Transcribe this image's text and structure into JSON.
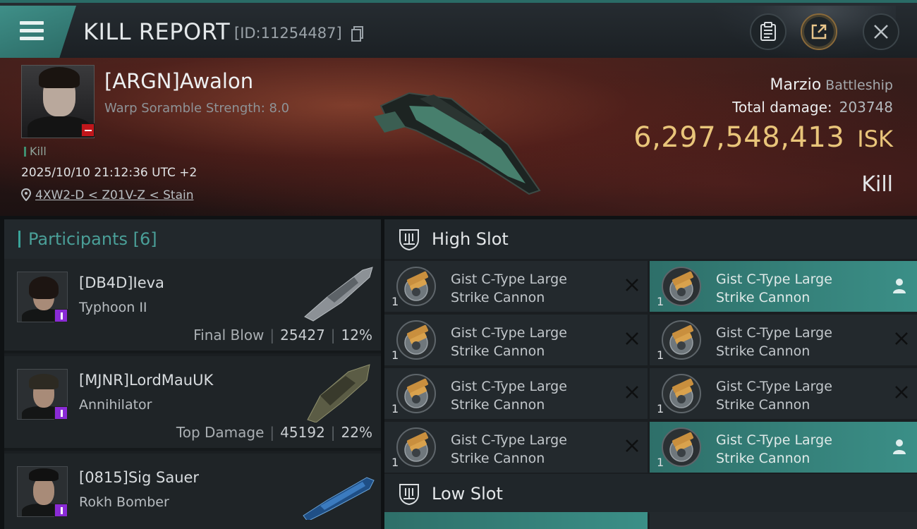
{
  "header": {
    "title": "KILL REPORT",
    "report_id": "[ID:11254487]"
  },
  "victim": {
    "name": "[ARGN]Awalon",
    "scramble": "Warp Soramble Strength: 8.0",
    "result_tag": "Kill",
    "datetime": "2025/10/10 21:12:36 UTC +2",
    "location": "4XW2-D < Z01V-Z < Stain",
    "ship_name": "Marzio",
    "ship_class": "Battleship",
    "total_damage_label": "Total damage:",
    "total_damage_value": "203748",
    "isk_value": "6,297,548,413",
    "isk_unit": "ISK",
    "kill_label": "Kill"
  },
  "participants": {
    "title": "Participants",
    "count": "[6]",
    "rows": [
      {
        "name": "[DB4D]Ieva",
        "ship": "Typhoon II",
        "role": "Final Blow",
        "damage": "25427",
        "percent": "12%"
      },
      {
        "name": "[MJNR]LordMauUK",
        "ship": "Annihilator",
        "role": "Top Damage",
        "damage": "45192",
        "percent": "22%"
      },
      {
        "name": "[0815]Sig Sauer",
        "ship": "Rokh Bomber",
        "role": "",
        "damage": "",
        "percent": ""
      }
    ]
  },
  "high_slot": {
    "title": "High Slot",
    "modules": [
      {
        "line1": "Gist C-Type Large",
        "line2": "Strike Cannon",
        "qty": "1",
        "state": "destroyed"
      },
      {
        "line1": "Gist C-Type Large",
        "line2": "Strike Cannon",
        "qty": "1",
        "state": "dropped"
      },
      {
        "line1": "Gist C-Type Large",
        "line2": "Strike Cannon",
        "qty": "1",
        "state": "destroyed"
      },
      {
        "line1": "Gist C-Type Large",
        "line2": "Strike Cannon",
        "qty": "1",
        "state": "destroyed"
      },
      {
        "line1": "Gist C-Type Large",
        "line2": "Strike Cannon",
        "qty": "1",
        "state": "destroyed"
      },
      {
        "line1": "Gist C-Type Large",
        "line2": "Strike Cannon",
        "qty": "1",
        "state": "destroyed"
      },
      {
        "line1": "Gist C-Type Large",
        "line2": "Strike Cannon",
        "qty": "1",
        "state": "destroyed"
      },
      {
        "line1": "Gist C-Type Large",
        "line2": "Strike Cannon",
        "qty": "1",
        "state": "dropped"
      }
    ]
  },
  "low_slot": {
    "title": "Low Slot"
  },
  "icons": {
    "menu": "hamburger-menu-icon",
    "copy": "copy-icon",
    "clipboard": "clipboard-icon",
    "share": "share-icon",
    "close": "close-icon",
    "location": "location-pin-icon",
    "destroyed": "close-x-icon",
    "dropped": "person-icon"
  },
  "colors": {
    "accent_teal": "#3b8f87",
    "isk_gold": "#e9c57a",
    "badge_red": "#c0161b",
    "badge_purple": "#8a2bd6"
  }
}
